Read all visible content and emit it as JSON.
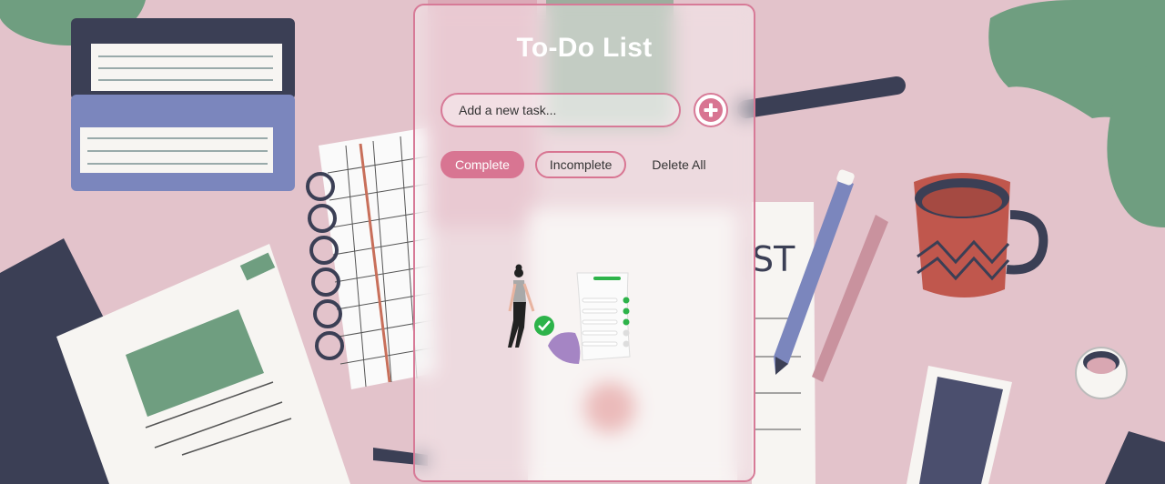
{
  "app": {
    "title": "To-Do List"
  },
  "task_input": {
    "placeholder": "Add a new task..."
  },
  "filters": {
    "complete_label": "Complete",
    "incomplete_label": "Incomplete",
    "delete_all_label": "Delete All"
  },
  "colors": {
    "accent": "#d87592",
    "background": "#e3c3cb",
    "check": "#2db34a"
  },
  "icons": {
    "add": "plus-circle-icon",
    "empty_state": "todo-checklist-illustration"
  },
  "background_art": {
    "list_sheet_text": "ST"
  }
}
